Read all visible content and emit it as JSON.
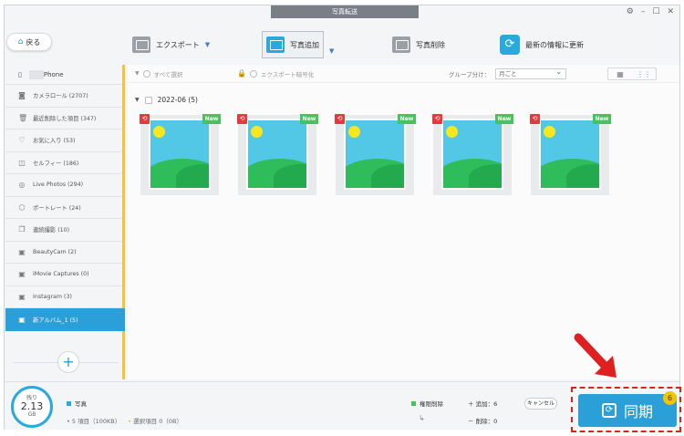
{
  "window": {
    "title": "写真転送"
  },
  "toolbar": {
    "back": "戻る",
    "export": "エクスポート",
    "add_photo": "写真追加",
    "delete_photo": "写真削除",
    "refresh": "最新の情報に更新"
  },
  "sidebar": {
    "device_name": "Phone",
    "items": [
      {
        "label": "カメラロール (2707)",
        "icon": "camera-icon"
      },
      {
        "label": "最近削除した項目 (347)",
        "icon": "trash-icon"
      },
      {
        "label": "お気に入り (53)",
        "icon": "heart-icon"
      },
      {
        "label": "セルフィー (186)",
        "icon": "selfie-icon"
      },
      {
        "label": "Live Photos (294)",
        "icon": "live-icon"
      },
      {
        "label": "ポートレート (24)",
        "icon": "portrait-icon"
      },
      {
        "label": "連続撮影 (10)",
        "icon": "burst-icon"
      },
      {
        "label": "BeautyCam (2)",
        "icon": "album-icon"
      },
      {
        "label": "iMovie Captures (0)",
        "icon": "album-icon"
      },
      {
        "label": "Instagram (3)",
        "icon": "album-icon"
      },
      {
        "label": "新アルバム_1 (5)",
        "icon": "album-icon",
        "active": true
      }
    ],
    "add_symbol": "+"
  },
  "filter": {
    "select_all": "すべて選択",
    "export_encrypt": "エクスポート暗号化",
    "group_label": "グループ分け：",
    "group_value": "月ごと"
  },
  "content": {
    "date_group": "2022-06 (5)",
    "photos": [
      {
        "badge": "New"
      },
      {
        "badge": "New"
      },
      {
        "badge": "New"
      },
      {
        "badge": "New"
      },
      {
        "badge": "New"
      }
    ]
  },
  "bottom": {
    "storage_label": "残り",
    "storage_value": "2.13",
    "storage_unit": "GB",
    "category": "写真",
    "items": "5 項目（100KB）",
    "selected": "選択項目 0（0B）",
    "permission_delete": "権限削除",
    "add_count": "追加：6",
    "delete_count": "削除：0",
    "cancel": "キャンセル",
    "sync": "同期",
    "sync_badge": "6"
  },
  "colors": {
    "accent": "#2a9fd8",
    "sidebar_active": "#2a9fd8",
    "new_badge": "#47c25d",
    "restore_badge": "#e33b3b",
    "highlight": "#e02020",
    "sync_badge": "#f5c400"
  }
}
